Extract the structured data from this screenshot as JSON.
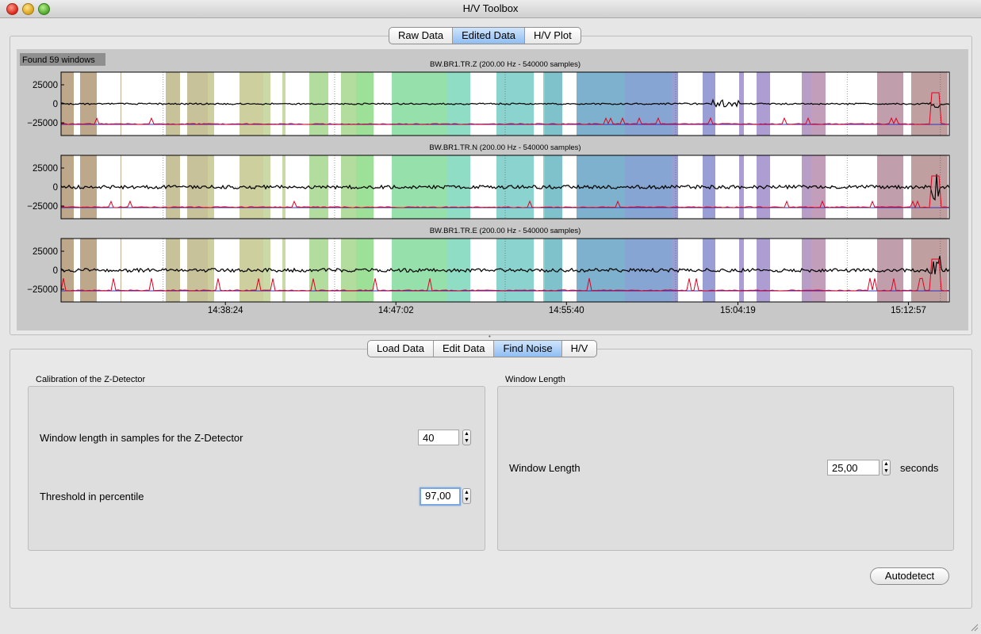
{
  "window": {
    "title": "H/V Toolbox"
  },
  "top_tabs": [
    "Raw Data",
    "Edited Data",
    "H/V Plot"
  ],
  "top_tabs_active": 1,
  "plot": {
    "found_label": "Found 59 windows",
    "traces": [
      {
        "name": "BW.BR1.TR.Z (200.00 Hz - 540000 samples)",
        "yticks": [
          "25000",
          "0",
          "−25000"
        ]
      },
      {
        "name": "BW.BR1.TR.N (200.00 Hz - 540000 samples)",
        "yticks": [
          "25000",
          "0",
          "−25000"
        ]
      },
      {
        "name": "BW.BR1.TR.E (200.00 Hz - 540000 samples)",
        "yticks": [
          "25000",
          "0",
          "−25000"
        ]
      }
    ],
    "xticks": [
      "14:38:24",
      "14:47:02",
      "14:55:40",
      "15:04:19",
      "15:12:57"
    ],
    "colors": {
      "trace": "#000000",
      "characteristic": "#e00020",
      "threshold": "#3030c0",
      "window_white": "#ffffff"
    }
  },
  "bottom_tabs": [
    "Load Data",
    "Edit Data",
    "Find Noise",
    "H/V"
  ],
  "bottom_tabs_active": 2,
  "zdetector": {
    "title": "Calibration of the Z-Detector",
    "window_label": "Window length in samples for the Z-Detector",
    "window_value": "40",
    "threshold_label": "Threshold in percentile",
    "threshold_value": "97,00"
  },
  "window_length": {
    "title": "Window Length",
    "label": "Window Length",
    "value": "25,00",
    "unit": "seconds"
  },
  "autodetect_label": "Autodetect",
  "icons": {
    "stepper": "stepper-arrows-icon",
    "resize": "resize-grip-icon"
  }
}
